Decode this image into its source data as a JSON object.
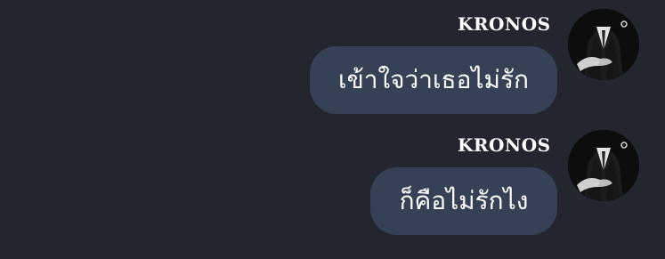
{
  "background_color": "#23262f",
  "bubble_color": "#364155",
  "messages": [
    {
      "sender": "KRONOS",
      "avatar_icon": "user-avatar-icon",
      "text": "เข้าใจว่าเธอไม่รัก"
    },
    {
      "sender": "KRONOS",
      "avatar_icon": "user-avatar-icon",
      "text": "ก็คือไม่รักไง"
    }
  ]
}
